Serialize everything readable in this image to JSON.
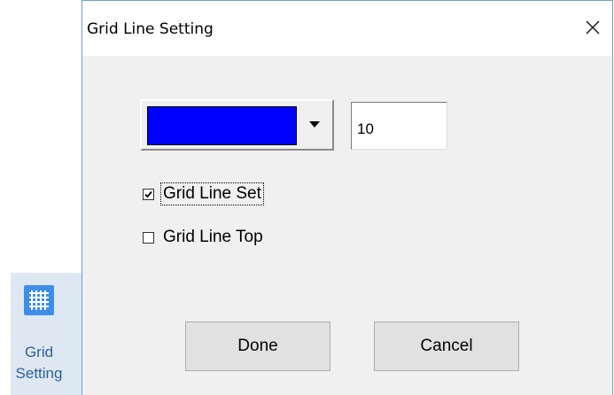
{
  "ribbon": {
    "button_label_line1": "Grid",
    "button_label_line2": "Setting",
    "icon": "grid-icon"
  },
  "dialog": {
    "title": "Grid Line Setting",
    "close_icon": "close-icon",
    "color_select": {
      "selected_color": "#0000ff",
      "arrow_icon": "dropdown-arrow-icon"
    },
    "width_value": "10",
    "checkboxes": [
      {
        "label": "Grid Line Set",
        "checked": true
      },
      {
        "label": "Grid Line Top",
        "checked": false
      }
    ],
    "buttons": {
      "done_label": "Done",
      "cancel_label": "Cancel"
    }
  },
  "colors": {
    "dialog_bg": "#f0f0f0",
    "dialog_border": "#6d9fd6",
    "ribbon_button_bg": "#dde8f3",
    "ribbon_icon_bg": "#3e8ee9",
    "ribbon_text": "#2f5f96"
  }
}
